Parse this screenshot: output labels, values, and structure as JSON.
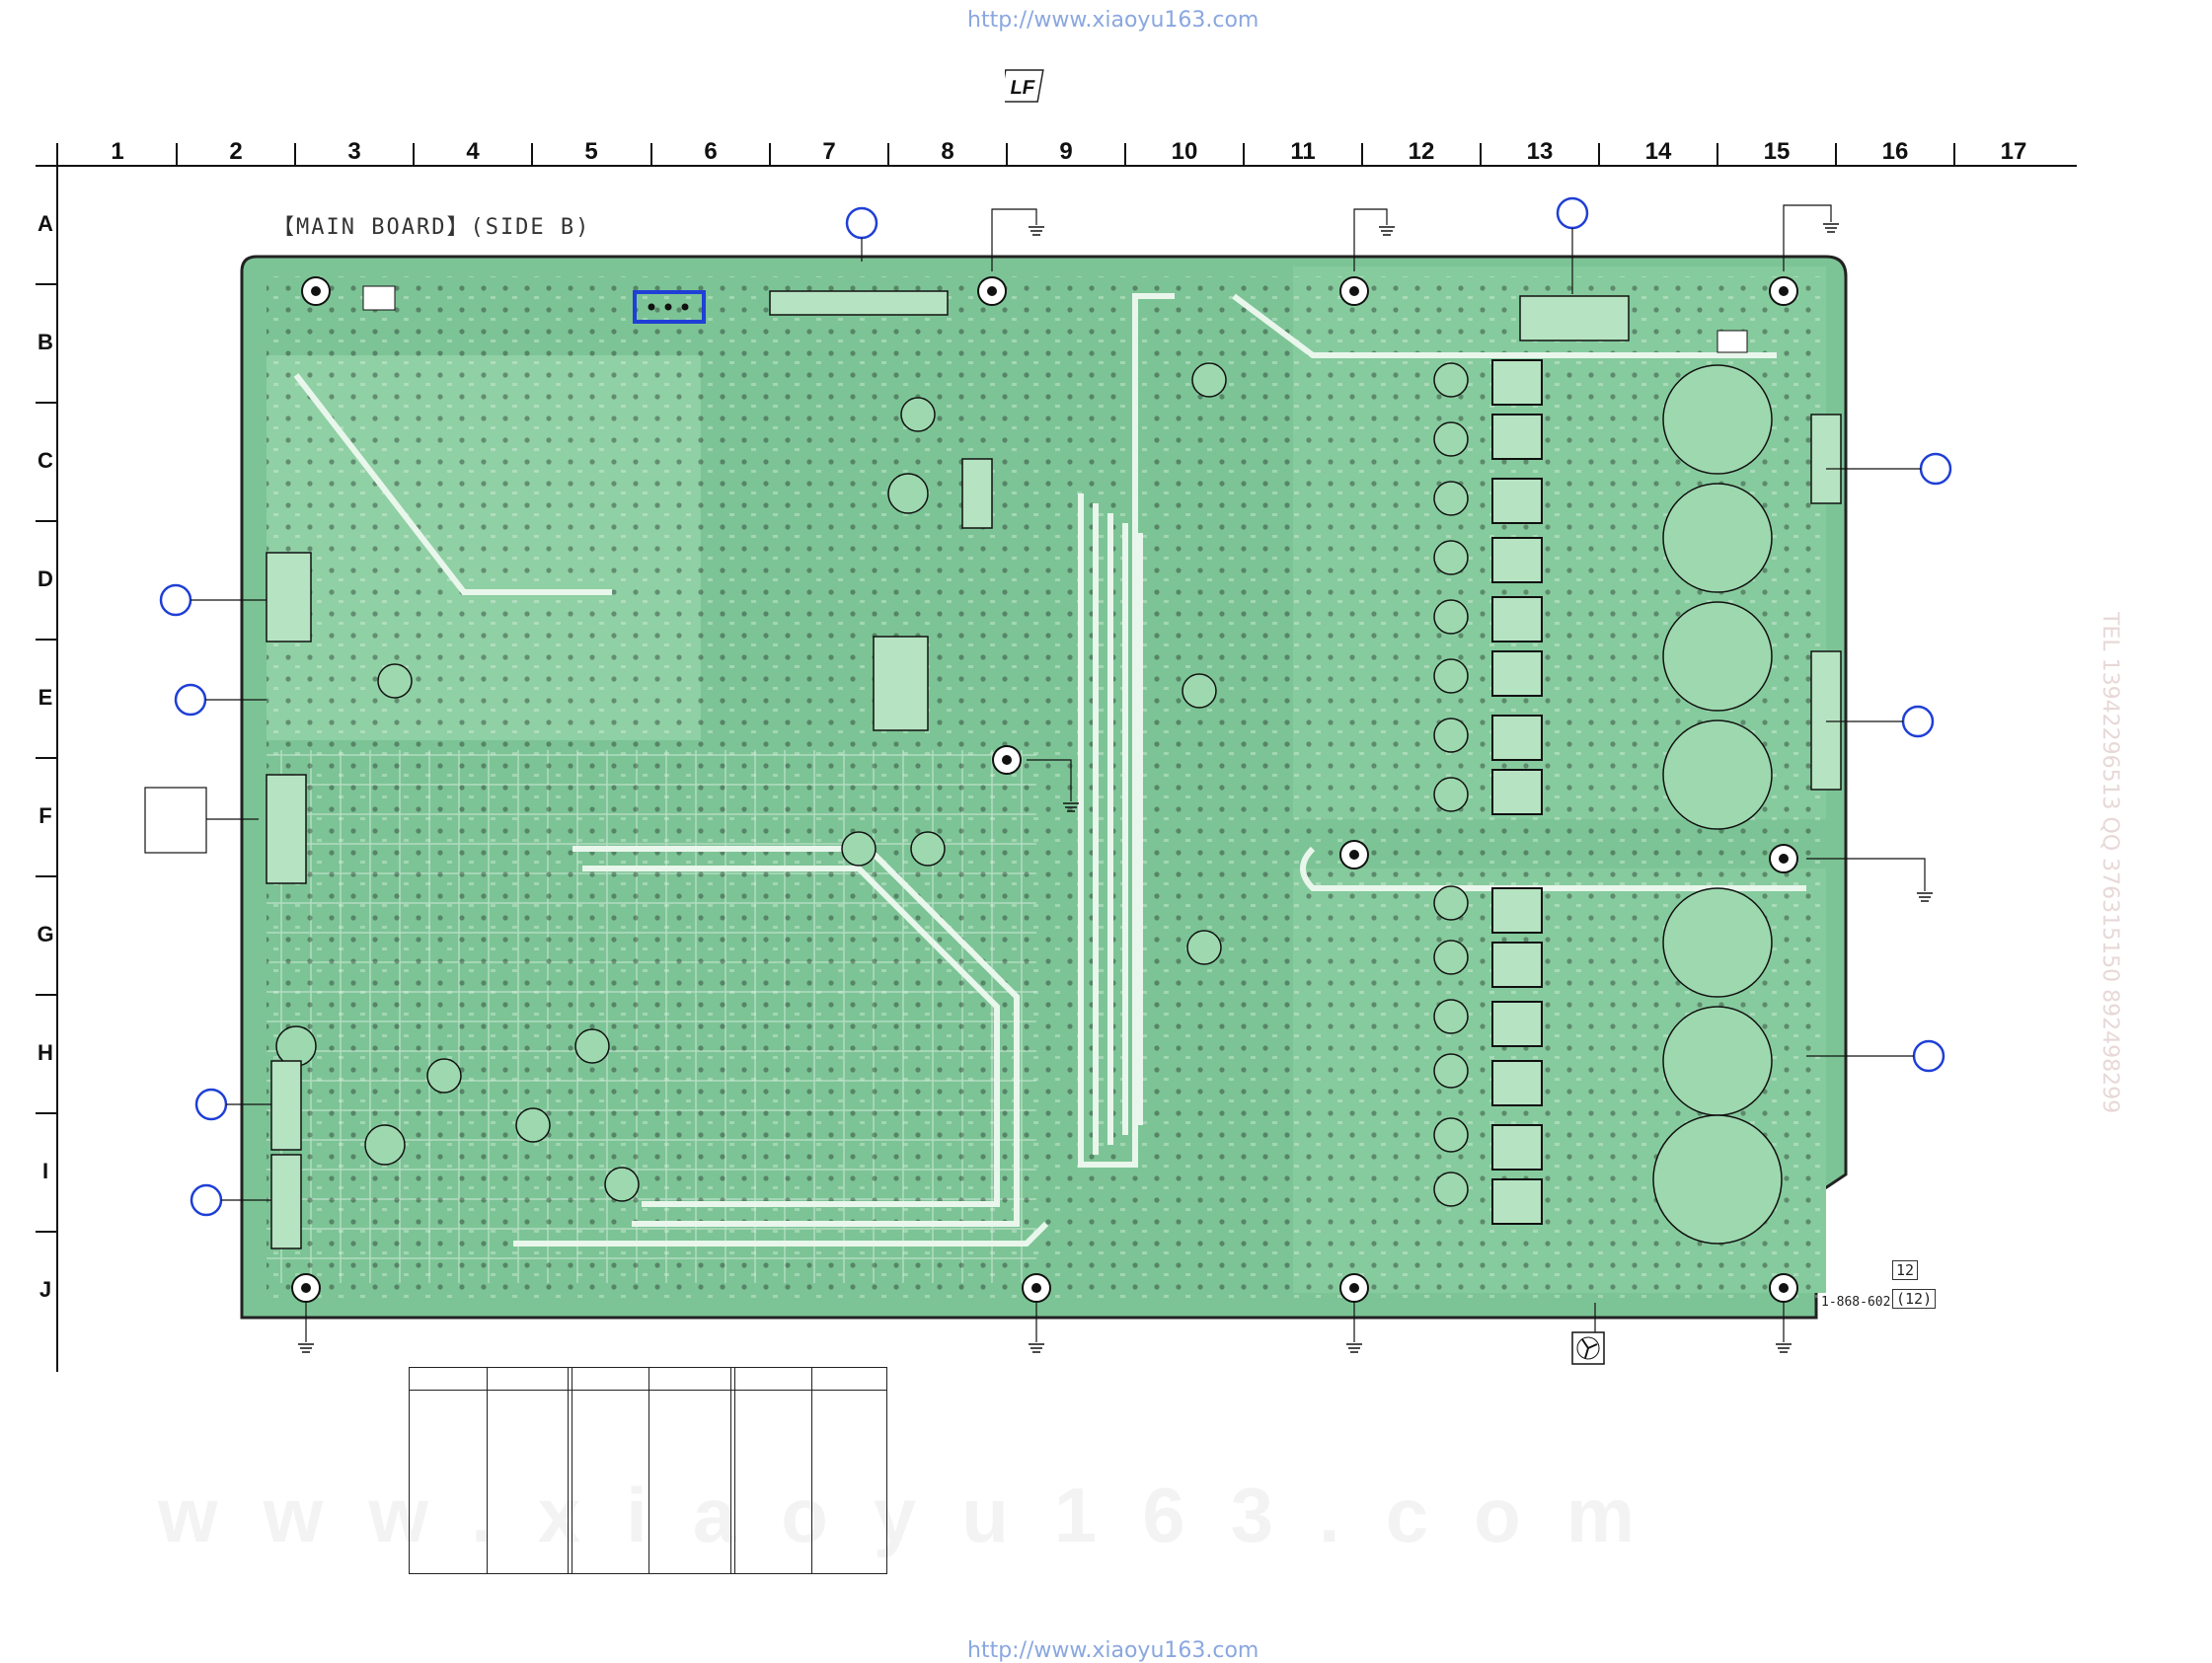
{
  "watermark_url": "http://www.xiaoyu163.com",
  "logo_text": "LF",
  "columns": [
    "1",
    "2",
    "3",
    "4",
    "5",
    "6",
    "7",
    "8",
    "9",
    "10",
    "11",
    "12",
    "13",
    "14",
    "15",
    "16",
    "17"
  ],
  "rows": [
    "A",
    "B",
    "C",
    "D",
    "E",
    "F",
    "G",
    "H",
    "I",
    "J"
  ],
  "board_title": "【MAIN BOARD】(SIDE B)",
  "board_code": "1-868-602-",
  "board_code_box1": "12",
  "board_code_box2": "(12)",
  "background_watermark": "www.xiaoyu163.com",
  "side_watermark": "TEL 13942296513  QQ 376315150  892498299",
  "colors": {
    "pcb_green": "#7cc495",
    "pcb_light": "#a6dcb4",
    "trace_white": "#e9f6ec",
    "marker_blue": "#1f3fd6",
    "outline": "#222222"
  }
}
